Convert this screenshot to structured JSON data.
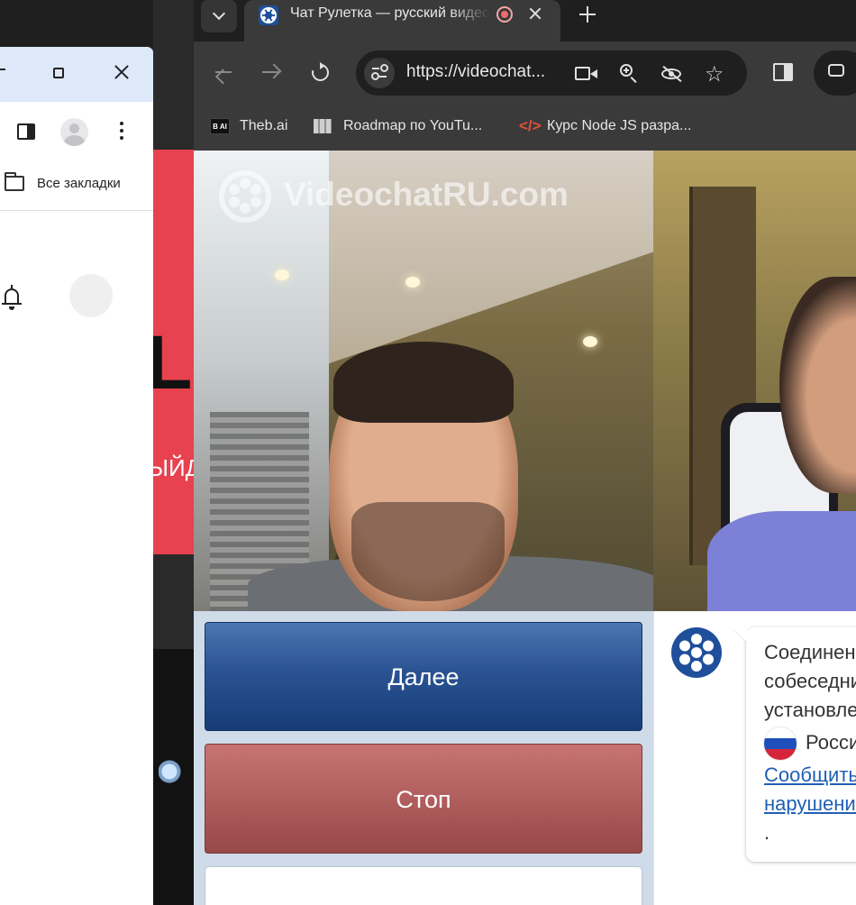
{
  "background_window": {
    "bookmarks_label": "Все закладки",
    "partial_page_text": "ЫЙД",
    "partial_logo_text": "LO"
  },
  "tab": {
    "title": "Чат Рулетка — русский видеочат",
    "favicon": "videochat-favicon"
  },
  "address_bar": {
    "url": "https://videochat..."
  },
  "bookmarks": [
    {
      "label": "Theb.ai",
      "icon": "theb-ai-icon"
    },
    {
      "label": "Roadmap по YouTu...",
      "icon": "roadmap-icon"
    },
    {
      "label": "Курс Node JS разра...",
      "icon": "code-icon"
    }
  ],
  "video": {
    "watermark": "VideochatRU.com"
  },
  "controls": {
    "next_label": "Далее",
    "stop_label": "Стоп"
  },
  "chat": {
    "lines": [
      "Соединение с",
      "собеседником",
      "установлено."
    ],
    "country": "Россия",
    "report_link_1": "Сообщить о",
    "report_link_2": "нарушении",
    "period": "."
  },
  "colors": {
    "next_button": "#2b5393",
    "stop_button": "#b05e5e",
    "brand_blue": "#1f4f9b",
    "control_bg": "#cfdbe8"
  }
}
